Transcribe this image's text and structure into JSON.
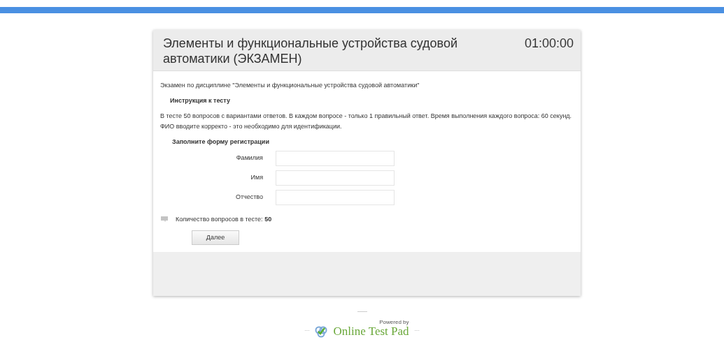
{
  "header": {
    "title": "Элементы и функциональные устройства судовой автоматики (ЭКЗАМЕН)",
    "timer": "01:00:00"
  },
  "description": "Экзамен по дисциплине \"Элементы и функциональные устройства судовой автоматики\"",
  "instruction": {
    "heading": "Инструкция к тесту",
    "text": "В тесте 50 вопросов с вариантами ответов. В каждом вопросе - только 1 правильный ответ. Время выполнения каждого вопроса: 60 секунд. ФИО вводите корректо - это необходимо для идентификации."
  },
  "form": {
    "heading": "Заполните форму регистрации",
    "fields": [
      {
        "label": "Фамилия"
      },
      {
        "label": "Имя"
      },
      {
        "label": "Отчество"
      }
    ]
  },
  "question_count": "Количество вопросов в тесте: **50**",
  "next_button": "Далее",
  "footer": {
    "powered_by": "Powered by",
    "brand": "Online Test Pad",
    "left_mark": "---",
    "right_mark": "---"
  }
}
